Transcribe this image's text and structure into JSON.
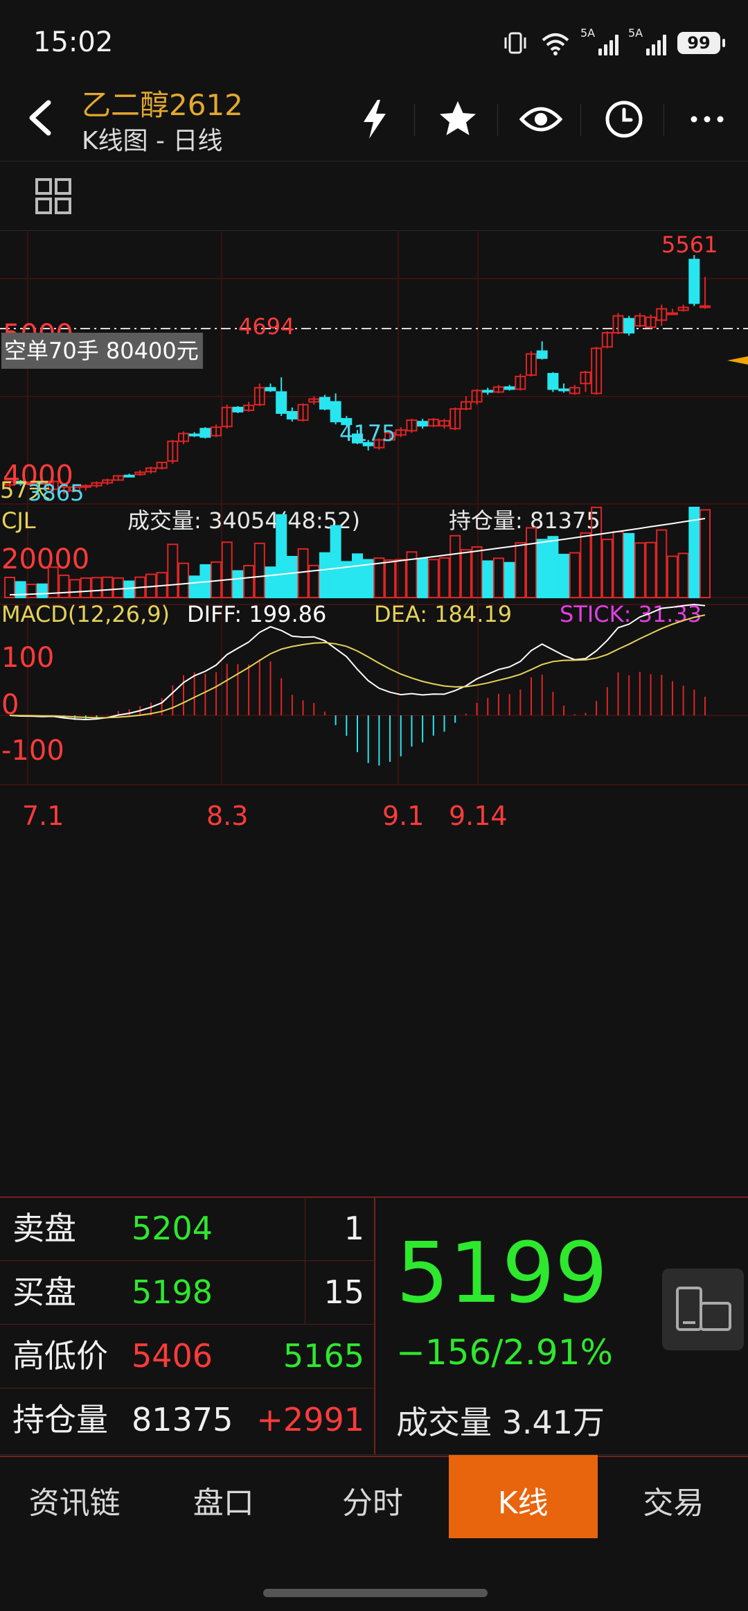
{
  "status_bar": {
    "time": "15:02",
    "battery": "99",
    "signal_label_1": "5A",
    "signal_label_2": "5A"
  },
  "header": {
    "title": "乙二醇2612",
    "subtitle": "K线图 - 日线"
  },
  "chart": {
    "price_axis_labels": [
      "5000",
      "4000"
    ],
    "high_label": "5561",
    "mid_high_label": "4694",
    "mid_low_label": "4175",
    "low_label": "3865",
    "ma_label": "57",
    "ma_label_suffix": "天",
    "order_label": "空单70手  80400元",
    "volume_panel": {
      "title": "CJL",
      "volume": "成交量: 34054(48:52)",
      "open_interest": "持仓量: 81375",
      "axis_label": "20000"
    },
    "macd_panel": {
      "title": "MACD(12,26,9)",
      "diff": "DIFF: 199.86",
      "dea": "DEA: 184.19",
      "stick": "STICK: 31.33",
      "axis_labels": [
        "100",
        "0",
        "-100"
      ]
    },
    "date_labels": [
      "7.1",
      "8.3",
      "9.1",
      "9.14"
    ],
    "colors": {
      "up": "#e02424",
      "down": "#27e6f0",
      "high_text": "#ff3b3b",
      "low_text": "#4fd7ee",
      "diff_line": "#ffffff",
      "dea_line": "#e5d35a"
    }
  },
  "chart_data": {
    "type": "candlestick",
    "ylim": [
      3820,
      5640
    ],
    "candles": [
      [
        3930,
        3955,
        3900,
        3960
      ],
      [
        3955,
        3940,
        3925,
        3965
      ],
      [
        3940,
        3950,
        3930,
        3958
      ],
      [
        3950,
        3940,
        3935,
        3962
      ],
      [
        3900,
        3955,
        3870,
        3965
      ],
      [
        3885,
        3915,
        3865,
        3925
      ],
      [
        3890,
        3915,
        3880,
        3920
      ],
      [
        3915,
        3925,
        3890,
        3935
      ],
      [
        3925,
        3945,
        3910,
        3955
      ],
      [
        3945,
        3965,
        3930,
        3975
      ],
      [
        3965,
        3995,
        3960,
        4000
      ],
      [
        3998,
        3990,
        3985,
        4010
      ],
      [
        4005,
        4020,
        3995,
        4035
      ],
      [
        4025,
        4050,
        4010,
        4060
      ],
      [
        4050,
        4090,
        4040,
        4095
      ],
      [
        4100,
        4240,
        4080,
        4250
      ],
      [
        4240,
        4295,
        4220,
        4310
      ],
      [
        4290,
        4280,
        4270,
        4305
      ],
      [
        4330,
        4270,
        4260,
        4340
      ],
      [
        4280,
        4340,
        4270,
        4360
      ],
      [
        4345,
        4480,
        4330,
        4500
      ],
      [
        4480,
        4450,
        4440,
        4490
      ],
      [
        4460,
        4495,
        4450,
        4520
      ],
      [
        4500,
        4620,
        4490,
        4650
      ],
      [
        4620,
        4600,
        4590,
        4650
      ],
      [
        4590,
        4440,
        4420,
        4694
      ],
      [
        4450,
        4400,
        4380,
        4480
      ],
      [
        4390,
        4500,
        4380,
        4510
      ],
      [
        4520,
        4540,
        4500,
        4560
      ],
      [
        4550,
        4470,
        4460,
        4570
      ],
      [
        4520,
        4380,
        4360,
        4580
      ],
      [
        4400,
        4360,
        4350,
        4420
      ],
      [
        4290,
        4230,
        4220,
        4320
      ],
      [
        4230,
        4210,
        4175,
        4250
      ],
      [
        4195,
        4250,
        4180,
        4260
      ],
      [
        4250,
        4300,
        4240,
        4310
      ],
      [
        4285,
        4320,
        4270,
        4340
      ],
      [
        4315,
        4390,
        4300,
        4400
      ],
      [
        4380,
        4350,
        4330,
        4400
      ],
      [
        4350,
        4395,
        4340,
        4405
      ],
      [
        4350,
        4385,
        4330,
        4400
      ],
      [
        4330,
        4470,
        4320,
        4480
      ],
      [
        4470,
        4520,
        4460,
        4560
      ],
      [
        4520,
        4600,
        4500,
        4610
      ],
      [
        4600,
        4590,
        4570,
        4620
      ],
      [
        4590,
        4625,
        4580,
        4640
      ],
      [
        4625,
        4610,
        4600,
        4640
      ],
      [
        4610,
        4700,
        4600,
        4720
      ],
      [
        4710,
        4860,
        4700,
        4880
      ],
      [
        4880,
        4830,
        4820,
        4950
      ],
      [
        4720,
        4610,
        4590,
        4730
      ],
      [
        4610,
        4600,
        4585,
        4650
      ],
      [
        4580,
        4620,
        4570,
        4640
      ],
      [
        4650,
        4730,
        4590,
        4740
      ],
      [
        4580,
        4900,
        4570,
        4910
      ],
      [
        4910,
        5010,
        4900,
        5020
      ],
      [
        5010,
        5130,
        5000,
        5150
      ],
      [
        5110,
        5010,
        4990,
        5130
      ],
      [
        5060,
        5130,
        5050,
        5150
      ],
      [
        5050,
        5120,
        5040,
        5140
      ],
      [
        5100,
        5180,
        5060,
        5210
      ],
      [
        5150,
        5150,
        5140,
        5180
      ],
      [
        5170,
        5190,
        5160,
        5210
      ],
      [
        5530,
        5220,
        5200,
        5561
      ],
      [
        5200,
        5200,
        5180,
        5406
      ]
    ]
  },
  "quote": {
    "rows": [
      {
        "label": "卖盘",
        "price": "5204",
        "qty": "1"
      },
      {
        "label": "买盘",
        "price": "5198",
        "qty": "15"
      },
      {
        "label": "高低价",
        "price": "5406",
        "qty": "5165"
      },
      {
        "label": "持仓量",
        "price": "81375",
        "qty": "+2991"
      }
    ],
    "last_price": "5199",
    "change": "−156/2.91%",
    "volume": "成交量 3.41万"
  },
  "nav": {
    "tabs": [
      "资讯链",
      "盘口",
      "分时",
      "K线",
      "交易"
    ],
    "active": "K线"
  }
}
